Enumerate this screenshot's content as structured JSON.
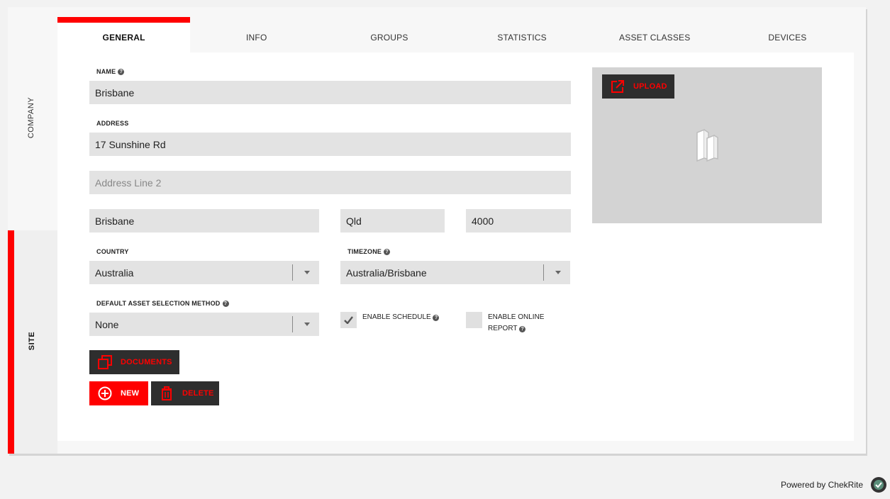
{
  "sidebar": {
    "company_label": "COMPANY",
    "site_label": "SITE"
  },
  "tabs": [
    {
      "label": "GENERAL",
      "active": true
    },
    {
      "label": "INFO"
    },
    {
      "label": "GROUPS"
    },
    {
      "label": "STATISTICS"
    },
    {
      "label": "ASSET CLASSES"
    },
    {
      "label": "DEVICES"
    }
  ],
  "form": {
    "name_label": "NAME",
    "name_value": "Brisbane",
    "address_label": "ADDRESS",
    "address_value": "17 Sunshine Rd",
    "address2_placeholder": "Address Line 2",
    "city_value": "Brisbane",
    "state_value": "Qld",
    "postcode_value": "4000",
    "country_label": "COUNTRY",
    "country_value": "Australia",
    "timezone_label": "TIMEZONE",
    "timezone_value": "Australia/Brisbane",
    "asset_method_label": "DEFAULT ASSET SELECTION METHOD",
    "asset_method_value": "None",
    "enable_schedule_label": "ENABLE SCHEDULE",
    "enable_schedule_checked": true,
    "enable_online_report_line1": "ENABLE ONLINE",
    "enable_online_report_line2": "REPORT",
    "enable_online_report_checked": false
  },
  "buttons": {
    "upload": "UPLOAD",
    "documents": "DOCUMENTS",
    "new": "NEW",
    "delete": "DELETE"
  },
  "footer": {
    "powered_by": "Powered by ChekRite"
  },
  "colors": {
    "accent": "#ff0000",
    "dark_button": "#2e2e2e",
    "field_bg": "#e3e3e3"
  }
}
